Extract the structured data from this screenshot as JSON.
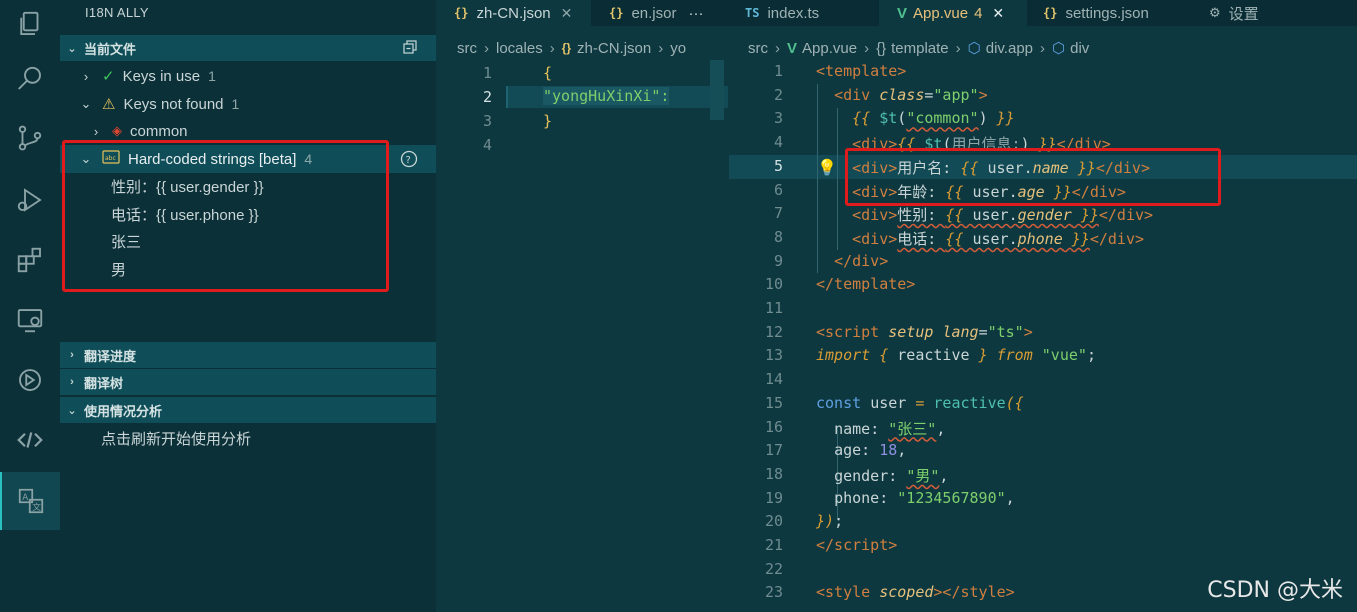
{
  "sidebar": {
    "title": "I18N ALLY",
    "current_file_header": "当前文件",
    "keys_in_use": {
      "label": "Keys in use",
      "count": "1"
    },
    "keys_not_found": {
      "label": "Keys not found",
      "count": "1"
    },
    "common_label": "common",
    "hardcoded": {
      "label": "Hard-coded strings [beta]",
      "count": "4"
    },
    "hardcoded_items": [
      "性别：{{ user.gender }}",
      "电话：{{ user.phone }}",
      "张三",
      "男"
    ],
    "progress_header": "翻译进度",
    "tree_header": "翻译树",
    "usage_header": "使用情况分析",
    "usage_hint": "点击刷新开始使用分析"
  },
  "tabs": {
    "zh_cn": "zh-CN.json",
    "en": "en.jsor",
    "more": "···",
    "index_ts_icon": "TS",
    "index_ts": "index.ts",
    "app_vue": "App.vue",
    "app_vue_count": "4",
    "close": "✕",
    "settings_json": "settings.json",
    "settings_ui": "设置",
    "json_icon": "{}"
  },
  "left_editor": {
    "breadcrumbs": [
      "src",
      "locales",
      "zh-CN.json",
      "yo"
    ],
    "line_numbers": [
      "1",
      "2",
      "3",
      "4"
    ],
    "lines": [
      "{",
      "\"yongHuXinXi\":",
      "}",
      ""
    ]
  },
  "right_editor": {
    "breadcrumbs": [
      "src",
      "App.vue",
      "template",
      "div.app",
      "div"
    ],
    "line_numbers": [
      "1",
      "2",
      "3",
      "4",
      "5",
      "6",
      "7",
      "8",
      "9",
      "10",
      "11",
      "12",
      "13",
      "14",
      "15",
      "16",
      "17",
      "18",
      "19",
      "20",
      "21",
      "22",
      "23"
    ]
  },
  "watermark": "CSDN @大米"
}
